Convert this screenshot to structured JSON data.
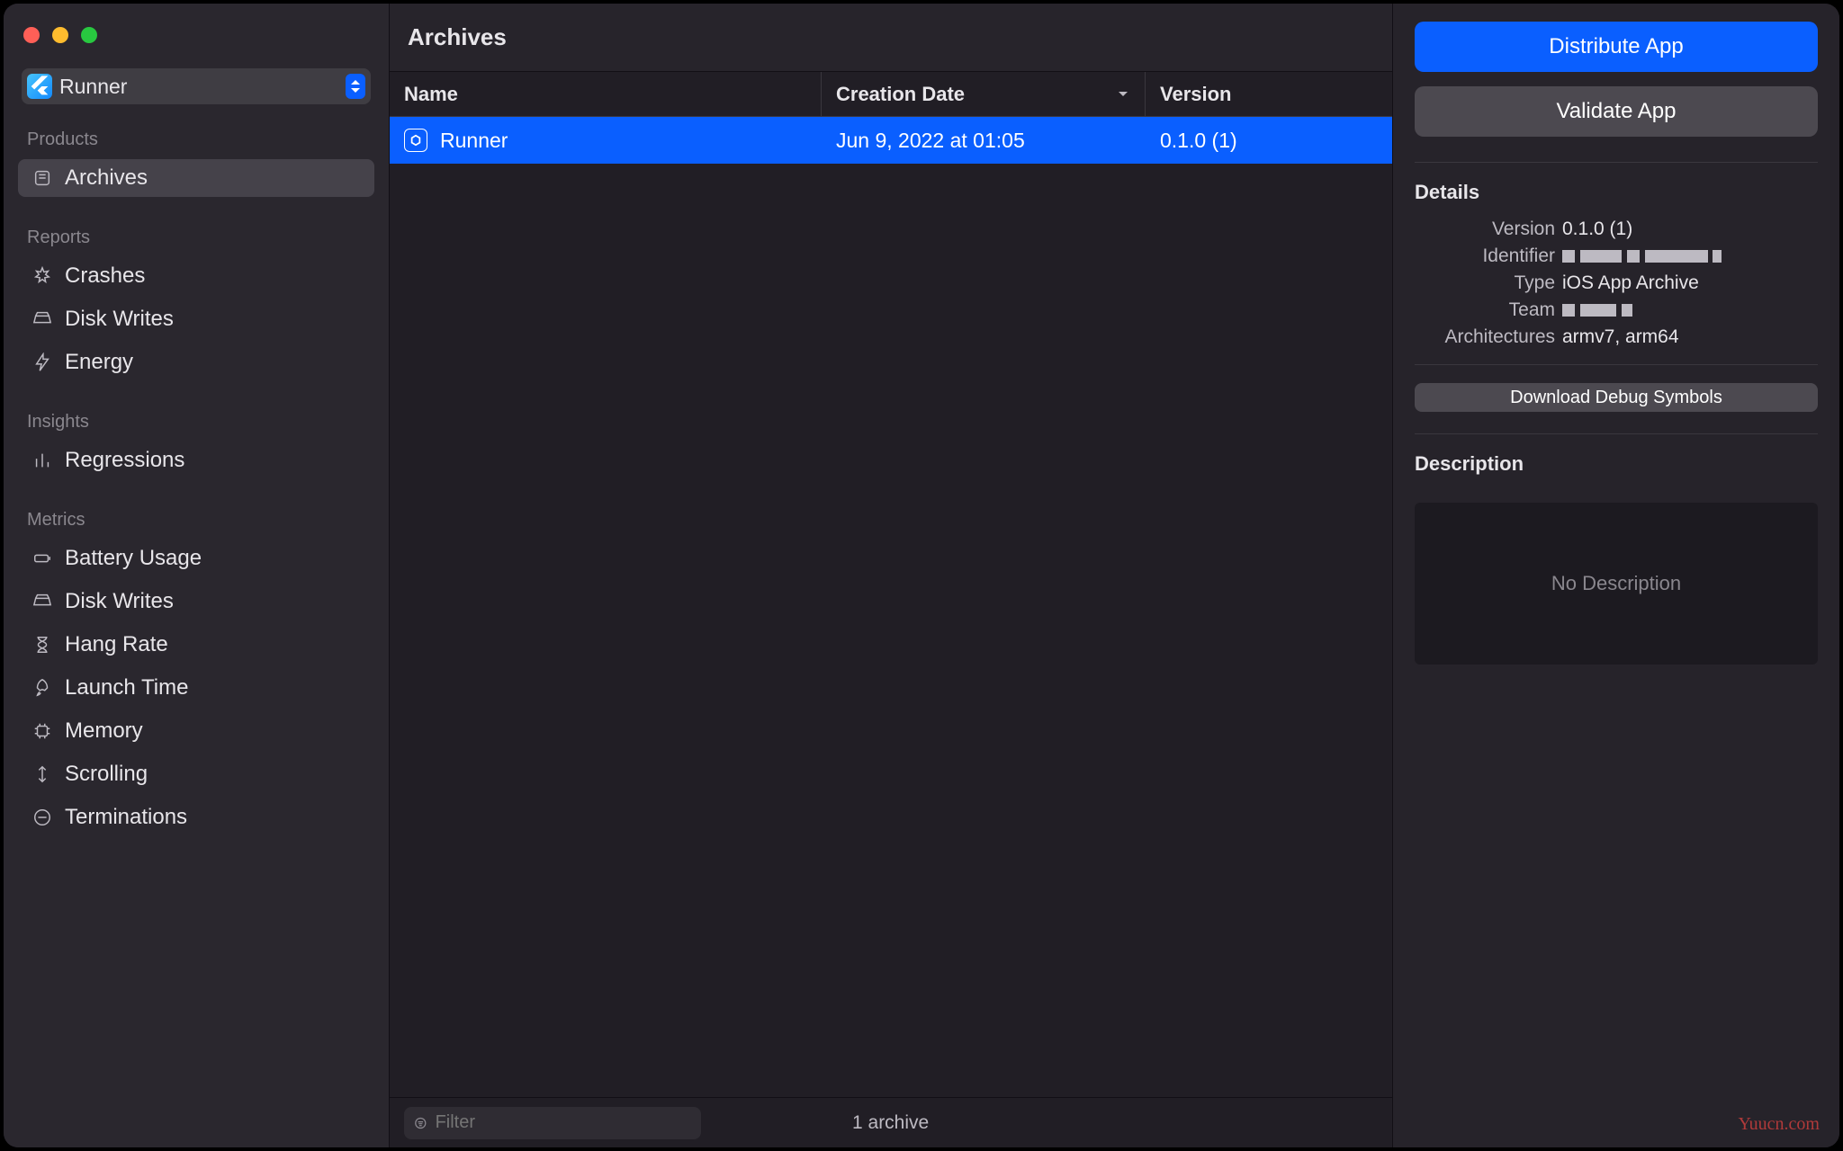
{
  "app_picker": {
    "label": "Runner"
  },
  "sidebar": {
    "products_label": "Products",
    "reports_label": "Reports",
    "insights_label": "Insights",
    "metrics_label": "Metrics",
    "archives": "Archives",
    "crashes": "Crashes",
    "disk_writes": "Disk Writes",
    "energy": "Energy",
    "regressions": "Regressions",
    "battery": "Battery Usage",
    "disk_writes2": "Disk Writes",
    "hang": "Hang Rate",
    "launch": "Launch Time",
    "memory": "Memory",
    "scrolling": "Scrolling",
    "terminations": "Terminations"
  },
  "main": {
    "title": "Archives",
    "columns": {
      "name": "Name",
      "date": "Creation Date",
      "version": "Version"
    },
    "rows": [
      {
        "name": "Runner",
        "date": "Jun 9, 2022 at 01:05",
        "version": "0.1.0 (1)"
      }
    ],
    "filter_placeholder": "Filter",
    "count_text": "1 archive"
  },
  "panel": {
    "distribute": "Distribute App",
    "validate": "Validate App",
    "details_label": "Details",
    "kv": {
      "version_k": "Version",
      "version_v": "0.1.0 (1)",
      "identifier_k": "Identifier",
      "type_k": "Type",
      "type_v": "iOS App Archive",
      "team_k": "Team",
      "arch_k": "Architectures",
      "arch_v": "armv7, arm64"
    },
    "download_symbols": "Download Debug Symbols",
    "description_label": "Description",
    "no_description": "No Description"
  },
  "watermark": "Yuucn.com"
}
